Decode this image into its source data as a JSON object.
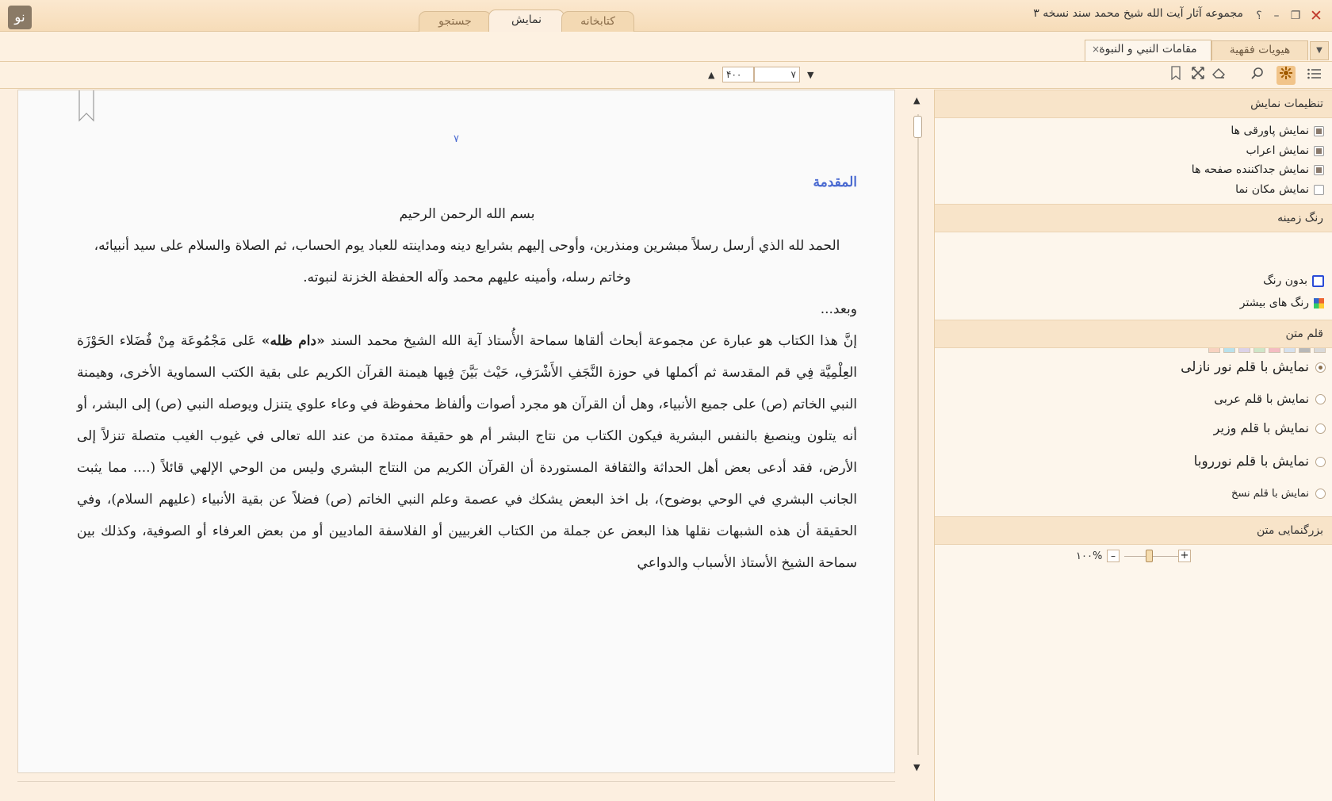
{
  "window": {
    "title": "مجموعه آثار آیت الله شیخ محمد سند نسخه ۳",
    "help_label": "؟",
    "minimize_label": "–",
    "restore_label": "❐",
    "close_label": "✕"
  },
  "app_logo": "نو",
  "main_tabs": [
    {
      "label": "کتابخانه",
      "active": false
    },
    {
      "label": "نمایش",
      "active": true
    },
    {
      "label": "جستجو",
      "active": false
    }
  ],
  "doc_tabs": [
    {
      "label": "هیویات فقهیة",
      "active": false
    },
    {
      "label": "مقامات النبي و النبوة",
      "active": true,
      "close": "×"
    }
  ],
  "toolbar": {
    "page_current": "۷",
    "page_total": "۴۰۰",
    "arrow_down": "▼",
    "arrow_up": "▲"
  },
  "content": {
    "page_number": "۷",
    "heading": "المقدمة",
    "basmala": "بسم الله الرحمن الرحيم",
    "hamd": "الحمد لله الذي أرسل رسلاً مبشرين ومنذرين، وأوحى إليهم بشرايع دينه ومداينته للعباد يوم الحساب، ثم الصلاة والسلام على سيد أنبيائه، وخاتم رسله، وأمينه عليهم محمد وآله الحفظة الخزنة لنبوته.",
    "wabaad": "وبعد...",
    "para_before_bold": "إنَّ هذا الكتاب هو عبارة عن مجموعة أبحاث ألقاها سماحة الأُستاذ آية الله الشيخ محمد السند ",
    "para_bold": "«دام ظله»",
    "para_after_bold": " عَلى مَجْمُوعَة مِنْ فُضَلاء الحَوْزَة العِلْمِيَّة فِي قم المقدسة ثم أكملها في حوزة النَّجَفِ الأَشْرَفِ، حَيْث بَيَّنَ فِيها هيمنة القرآن الكريم على بقية الكتب السماوية الأخرى، وهيمنة النبي الخاتم (ص) على جميع الأنبياء، وهل أن القرآن هو مجرد أصوات وألفاظ محفوظة في وعاء علوي يتنزل ويوصله النبي (ص) إلى البشر، أو أنه يتلون وينصبغ بالنفس البشرية فيكون الكتاب من نتاج البشر أم هو حقيقة ممتدة من عند الله تعالى في غيوب الغيب متصلة تنزلاً إلى الأرض، فقد أدعى بعض أهل الحداثة والثقافة المستوردة أن القرآن الكريم من النتاج البشري وليس من الوحي الإلهي قائلاً (.... مما يثبت الجانب البشري في الوحي بوضوح)، بل اخذ البعض يشكك في عصمة وعلم النبي الخاتم (ص) فضلاً عن بقية الأنبياء (عليهم السلام)، وفي الحقيقة أن هذه الشبهات نقلها هذا البعض عن جملة من الكتاب الغربيين أو الفلاسفة الماديين أو من بعض العرفاء أو الصوفية، وكذلك بين سماحة الشيخ الأستاذ الأسباب والدواعي"
  },
  "panel": {
    "display_settings": {
      "title": "تنظیمات نمایش",
      "options": [
        {
          "label": "نمایش پاورقی ها",
          "checked": true
        },
        {
          "label": "نمایش اعراب",
          "checked": true
        },
        {
          "label": "نمایش جداکننده صفحه ها",
          "checked": true
        },
        {
          "label": "نمایش مکان نما",
          "checked": false
        }
      ]
    },
    "background": {
      "title": "رنگ زمینه",
      "swatches": [
        "#d9d9d9",
        "#b8b8b8",
        "#d6e1ee",
        "#f4bcc2",
        "#cfe6c8",
        "#dcd2e8",
        "#b9e1ec",
        "#f8d2c0"
      ],
      "no_color_label": "بدون رنگ",
      "more_colors_label": "رنگ های بیشتر"
    },
    "font": {
      "title": "قلم متن",
      "options": [
        {
          "label": "نمایش با قلم نور نازلی",
          "checked": true
        },
        {
          "label": "نمایش با قلم عربی",
          "checked": false
        },
        {
          "label": "نمایش با قلم وزیر",
          "checked": false
        },
        {
          "label": "نمایش با قلم نورروبا",
          "checked": false
        },
        {
          "label": "نمایش با قلم نسخ",
          "checked": false
        }
      ]
    },
    "zoom": {
      "title": "بزرگنمایی متن",
      "value": "۱۰۰%",
      "minus": "–",
      "plus": "+",
      "level": 0.5
    }
  },
  "colors": {
    "accent": "#4a6ad1",
    "titlebar": "#f6dcb8",
    "panel_header": "#f8e4c9"
  }
}
